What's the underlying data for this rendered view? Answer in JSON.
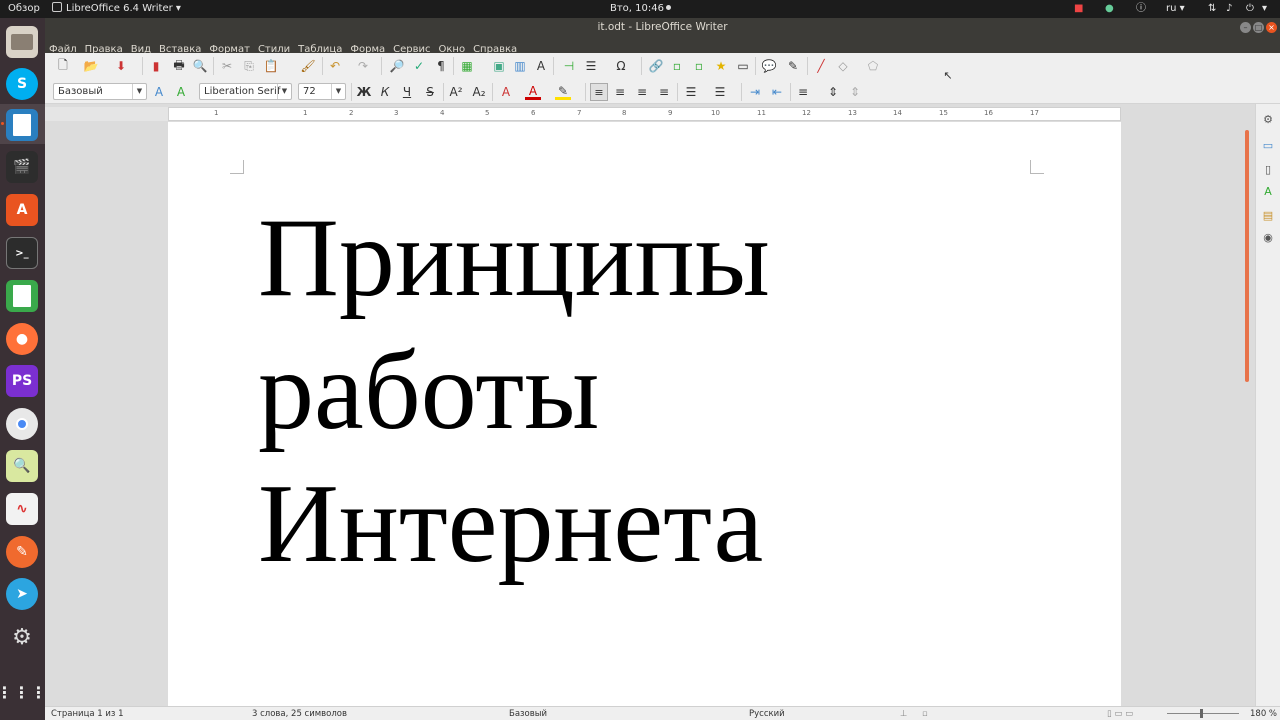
{
  "topbar": {
    "activities": "Обзор",
    "app_menu": "LibreOffice 6.4 Writer",
    "clock": "Вто, 10:46",
    "language": "ru"
  },
  "window": {
    "title": "it.odt - LibreOffice Writer"
  },
  "menu": [
    "Файл",
    "Правка",
    "Вид",
    "Вставка",
    "Формат",
    "Стили",
    "Таблица",
    "Форма",
    "Сервис",
    "Окно",
    "Справка"
  ],
  "formatting": {
    "paragraph_style": "Базовый",
    "font_name": "Liberation Serif",
    "font_size": "72"
  },
  "ruler": {
    "ticks": [
      "1",
      "1",
      "2",
      "3",
      "4",
      "5",
      "6",
      "7",
      "8",
      "9",
      "10",
      "11",
      "12",
      "13",
      "14",
      "15",
      "16",
      "17"
    ]
  },
  "document": {
    "lines": [
      "Принципы",
      "работы",
      "Интернета"
    ]
  },
  "status": {
    "page": "Страница 1 из 1",
    "words": "3 слова, 25 символов",
    "style": "Базовый",
    "language": "Русский",
    "zoom": "180 %"
  }
}
